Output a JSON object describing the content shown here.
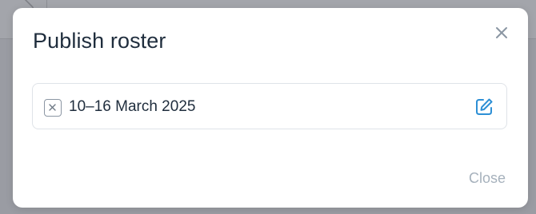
{
  "dialog": {
    "title": "Publish roster",
    "close_button_label": "Close"
  },
  "roster_range": {
    "label": "10–16 March 2025"
  },
  "icons": {
    "dismiss": "close-icon",
    "remove": "remove-icon",
    "edit": "edit-icon"
  },
  "colors": {
    "accent": "#2d8fd5",
    "muted_text": "#a6b1bc",
    "title_text": "#1f2d3d"
  }
}
